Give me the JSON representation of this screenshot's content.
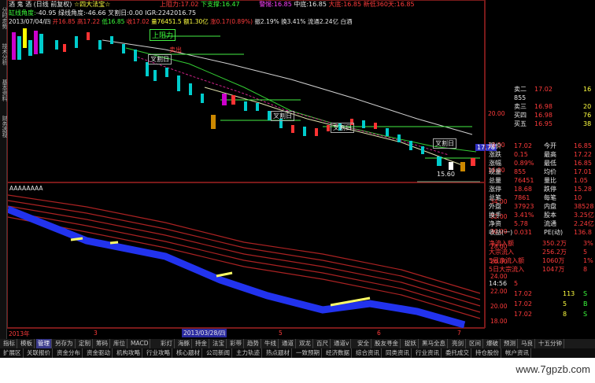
{
  "header": {
    "title": "酒 鬼 酒",
    "period": "(日线 前复权)",
    "indicator": "☆四大法宝☆",
    "upper_label": "上阻力:",
    "upper_value": "17.02",
    "lower_label": "下支撑:",
    "lower_value": "16.47",
    "warn_label": "警惕:",
    "warn_value": "16.85",
    "mid_label": "中底:",
    "mid_value": "16.85",
    "big_label": "大底:",
    "big_value": "16.85",
    "new_label": "新低360天:",
    "new_value": "16.85",
    "line2_a": "缸线角度:",
    "line2_a_val": "-40.95",
    "line2_b": "绿线角度:",
    "line2_b_val": "-46.66",
    "line2_c": "叉割日:",
    "line2_c_val": "0.00",
    "line2_d": "IGR:",
    "line2_d_val": "2242016.75",
    "line3": "2013/07/04/四",
    "line3_open": "开16.85",
    "line3_high": "高17.22",
    "line3_low": "低16.85",
    "line3_close": "收17.02",
    "line3_vol": "量76451.5",
    "line3_amt": "额1.30亿",
    "line3_chg": "涨0.17(0.89%)",
    "line3_amp": "振2.19%",
    "line3_turn": "换3.41%",
    "line3_circ": "流通2.24亿",
    "line3_flag": "白酒"
  },
  "main_chart": {
    "ann_upper_resist": "上阻力",
    "ann_sell": "卖出",
    "ann_cross1": "叉割日",
    "ann_cross2": "叉割日",
    "ann_cross3": "叉割日",
    "ann_cross4": "叉割日",
    "ann_low": "15.60",
    "ann_high_left": "?",
    "price_ticks": [
      "20.00",
      "18.00",
      "16.00"
    ],
    "current_price_tag": "17.78"
  },
  "lower_chart": {
    "header": "AAAAAAAA",
    "price_ticks": [
      "34.00",
      "32.00",
      "30.00",
      "28.00",
      "26.00",
      "24.00",
      "22.00",
      "20.00",
      "18.00"
    ]
  },
  "quotes": {
    "sell": [
      {
        "label": "卖二",
        "price": "17.02",
        "vol": "16"
      },
      {
        "label": "卖三",
        "price": "16.98",
        "vol": "20"
      },
      {
        "label": "买四",
        "price": "16.98",
        "vol": "76"
      },
      {
        "label": "买五",
        "price": "16.95",
        "vol": "38"
      }
    ],
    "top_value": "855",
    "price_rows": [
      {
        "l1": "现价",
        "v1": "17.02",
        "l2": "今开",
        "v2": "16.85"
      },
      {
        "l1": "涨跌",
        "v1": "0.15",
        "l2": "最高",
        "v2": "17.22"
      },
      {
        "l1": "涨幅",
        "v1": "0.89%",
        "l2": "最低",
        "v2": "16.85"
      },
      {
        "l1": "现量",
        "v1": "855",
        "l2": "均价",
        "v2": "17.01"
      },
      {
        "l1": "总量",
        "v1": "76451",
        "l2": "量比",
        "v2": "1.05"
      },
      {
        "l1": "涨停",
        "v1": "18.68",
        "l2": "跌停",
        "v2": "15.28"
      },
      {
        "l1": "总笔",
        "v1": "7861",
        "l2": "每笔",
        "v2": "10"
      },
      {
        "l1": "外盘",
        "v1": "37923",
        "l2": "内盘",
        "v2": "38528"
      },
      {
        "l1": "换手",
        "v1": "3.41%",
        "l2": "股本",
        "v2": "3.25亿"
      },
      {
        "l1": "净资",
        "v1": "5.78",
        "l2": "流通",
        "v2": "2.24亿"
      },
      {
        "l1": "收益(一)",
        "v1": "0.031",
        "l2": "PE(动)",
        "v2": "136.8"
      }
    ],
    "flow_rows": [
      {
        "label": "净流入额",
        "value": "350.2万",
        "extra": "3%"
      },
      {
        "label": "大宗流入",
        "value": "256.2万",
        "extra": "5"
      },
      {
        "label": "5日净流入额",
        "value": "1060万",
        "extra": "1%"
      },
      {
        "label": "5日大宗流入",
        "value": "1047万",
        "extra": "8"
      }
    ],
    "ticks": [
      {
        "time": "14:56",
        "price": "5",
        "vol": "",
        "flag": ""
      },
      {
        "time": "",
        "price": "17.02",
        "vol": "113",
        "flag": "S"
      },
      {
        "time": "",
        "price": "17.02",
        "vol": "5",
        "flag": "B"
      },
      {
        "time": "",
        "price": "17.02",
        "vol": "8",
        "flag": "S"
      }
    ]
  },
  "xaxis": {
    "labels": [
      "2013年",
      "3",
      "2013/03/28/四",
      "5",
      "6",
      "7"
    ]
  },
  "bottom_tabs": [
    "指标",
    "模板",
    "管理",
    "另存为",
    "定制",
    "筹码",
    "库位",
    "MACD",
    "彩灯",
    "海豚",
    "持金",
    "法宝",
    "彩带",
    "趋势",
    "牛线",
    "通道",
    "双龙",
    "百尺",
    "通道v",
    "安全",
    "股友寻金",
    "捉妖",
    "黑马全息",
    "亮剑",
    "区间",
    "爆破",
    "预测",
    "马良",
    "十五分钟"
  ],
  "bottom_bar": [
    "扩展区",
    "关联报价",
    "资金分布",
    "资金驱动",
    "机构攻略",
    "行业攻略",
    "核心题材",
    "公司新闻",
    "主力轨迹",
    "热点题材",
    "一致预期",
    "经济数据",
    "综合资讯",
    "同类资讯",
    "行业资讯",
    "委托成交",
    "持仓股份",
    "帐户资讯"
  ],
  "left_vtabs": [
    "分时走势",
    "技术分析",
    "基本资料",
    "财务透视"
  ],
  "watermark": "www.7gpzb.com"
}
